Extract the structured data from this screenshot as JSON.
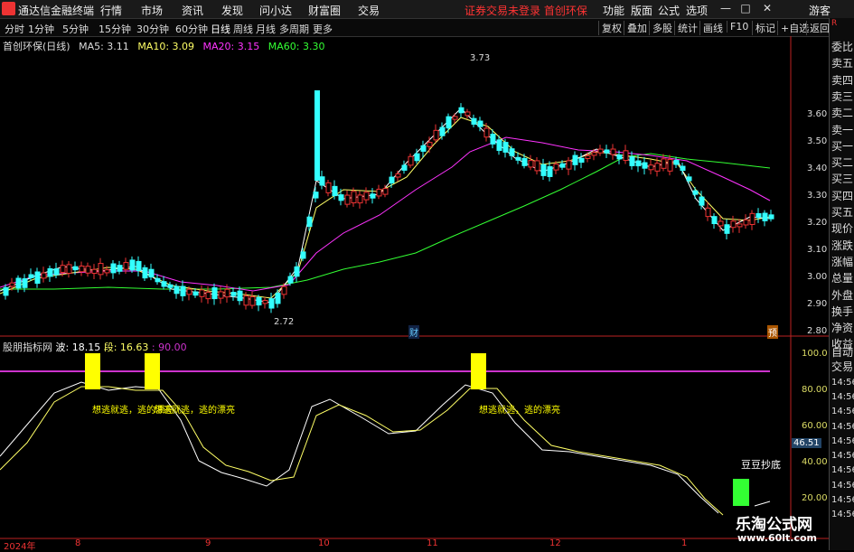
{
  "app": {
    "title": "通达信金融终端"
  },
  "menu": [
    "行情",
    "市场",
    "资讯",
    "发现",
    "问小达",
    "财富圈",
    "交易"
  ],
  "status_text": "证券交易未登录  首创环保",
  "top_right": [
    "功能",
    "版面",
    "公式",
    "选项"
  ],
  "guest": "游客",
  "periods": [
    "分时",
    "1分钟",
    "5分钟",
    "15分钟",
    "30分钟",
    "60分钟",
    "日线",
    "周线",
    "月线",
    "多周期",
    "更多"
  ],
  "active_period": "日线",
  "tool_buttons": [
    "复权",
    "叠加",
    "多股",
    "统计",
    "画线",
    "F10",
    "标记",
    "+自选",
    "返回"
  ],
  "main_legend": {
    "name": "首创环保(日线)",
    "ma5": "MA5: 3.11",
    "ma10": "MA10: 3.09",
    "ma20": "MA20: 3.15",
    "ma60": "MA60: 3.30"
  },
  "price_axis": [
    "3.60",
    "3.50",
    "3.40",
    "3.30",
    "3.20",
    "3.10",
    "3.00",
    "2.90",
    "2.80"
  ],
  "annotations": {
    "high": "3.73",
    "low": "2.72",
    "cai": "财",
    "yu": "预"
  },
  "indicator_legend": {
    "name": "股朋指标网",
    "bo": "波: 18.15",
    "duan": "段: 16.63",
    "line": ": 90.00"
  },
  "indicator_axis": [
    "100.0",
    "80.00",
    "60.00",
    "40.00",
    "20.00"
  ],
  "indicator_value_tag": "46.51",
  "signal_texts": [
    "想逃就逃，逃的漂亮",
    "想逃就逃，逃的漂亮",
    "想逃就逃，逃的漂亮"
  ],
  "dou_label": "豆豆抄底",
  "dates": [
    "2024年",
    "8",
    "9",
    "10",
    "11",
    "12",
    "1"
  ],
  "right_panel_top": [
    "委比",
    "卖五",
    "卖四",
    "卖三",
    "卖二",
    "卖一",
    "买一",
    "买二",
    "买三",
    "买四",
    "买五",
    "现价",
    "涨跌",
    "涨幅",
    "总量",
    "外盘",
    "换手",
    "净资",
    "收益"
  ],
  "right_panel_bottom": [
    "自动",
    "交易",
    "14:56",
    "14:56",
    "14:56",
    "14:56",
    "14:56",
    "14:56",
    "14:56",
    "14:56",
    "14:56",
    "14:56"
  ],
  "watermark": {
    "line1": "乐淘公式网",
    "line2": "www.60lt.com"
  },
  "colors": {
    "up": "#e33",
    "down": "#3ff",
    "ma5": "#fff",
    "ma10": "#ff6",
    "ma20": "#f3f",
    "ma60": "#3f3",
    "signal": "#ff0"
  }
}
